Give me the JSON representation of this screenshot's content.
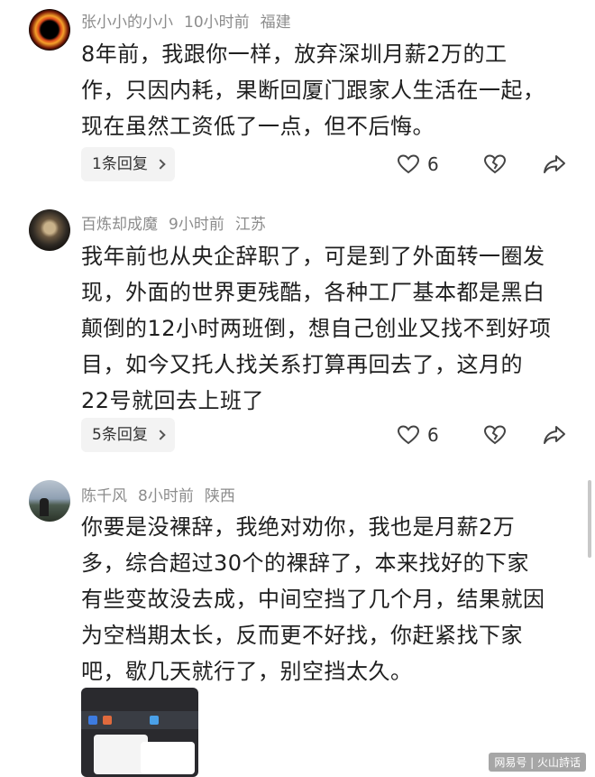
{
  "comments": [
    {
      "username": "张小小的小小",
      "time": "10小时前",
      "location": "福建",
      "lines": [
        "8年前，我跟你一样，放弃深圳月薪2万的工",
        "作，只因内耗，果断回厦门跟家人生活在一起，",
        "现在虽然工资低了一点，但不后悔。"
      ],
      "reply_label": "1条回复",
      "like_count": "6"
    },
    {
      "username": "百炼却成魔",
      "time": "9小时前",
      "location": "江苏",
      "lines": [
        "我年前也从央企辞职了，可是到了外面转一圈发",
        "现，外面的世界更残酷，各种工厂基本都是黑白",
        "颠倒的12小时两班倒，想自己创业又找不到好项",
        "目，如今又托人找关系打算再回去了，这月的",
        "22号就回去上班了"
      ],
      "reply_label": "5条回复",
      "like_count": "6"
    },
    {
      "username": "陈千风",
      "time": "8小时前",
      "location": "陕西",
      "lines": [
        "你要是没裸辞，我绝对劝你，我也是月薪2万",
        "多，综合超过30个的裸辞了，本来找好的下家",
        "有些变故没去成，中间空挡了几个月，结果就因",
        "为空档期太长，反而更不好找，你赶紧找下家",
        "吧，歇几天就行了，别空挡太久。"
      ]
    }
  ],
  "watermark": "网易号 | 火山詩话",
  "icons": {
    "like": "heart-outline-icon",
    "dislike": "broken-heart-icon",
    "share": "share-arrow-icon"
  }
}
